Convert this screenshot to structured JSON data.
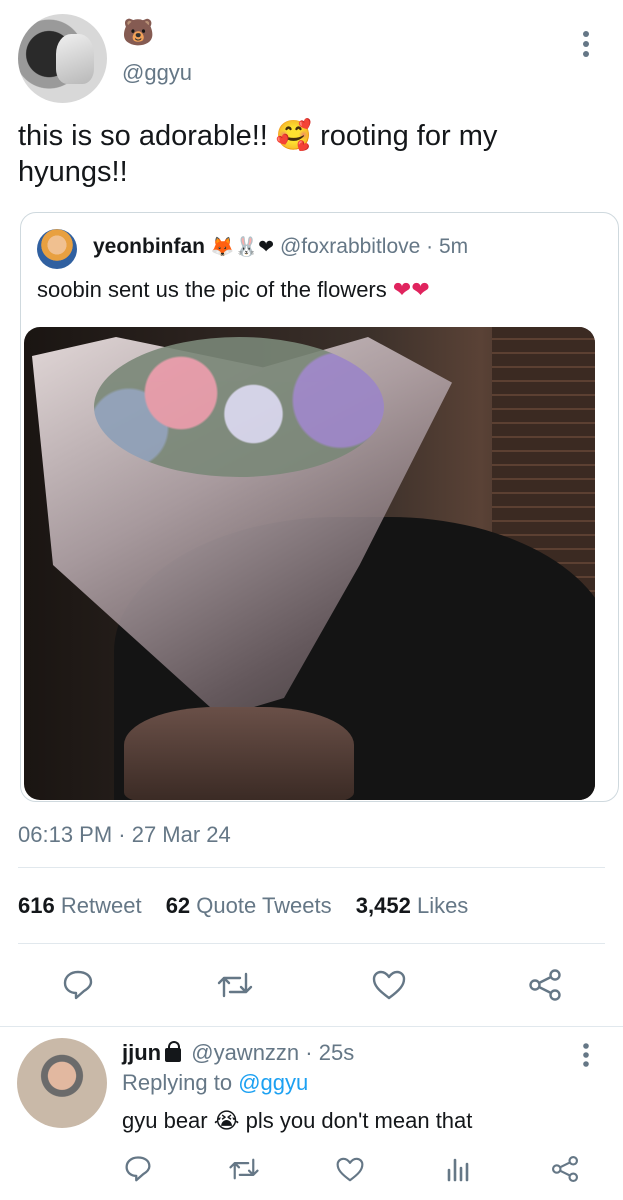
{
  "tweet": {
    "display_name": "🐻",
    "handle": "@ggyu",
    "text": "this is so adorable!! 🥰 rooting for my hyungs!!",
    "timestamp": "06:13 PM · 27 Mar 24",
    "more_icon": "more-vertical-icon"
  },
  "quote": {
    "name": "yeonbinfan",
    "name_emojis": "🦊🐰❤",
    "handle": "@foxrabbitlove",
    "time": "· 5m",
    "text": "soobin sent us the pic of the flowers",
    "text_emojis": "❤❤"
  },
  "stats": {
    "retweets_count": "616",
    "retweets_label": "Retweet",
    "quotes_count": "62",
    "quotes_label": "Quote Tweets",
    "likes_count": "3,452",
    "likes_label": "Likes"
  },
  "actions": [
    "reply-icon",
    "retweet-icon",
    "like-icon",
    "share-icon"
  ],
  "reply": {
    "name": "jjun",
    "handle": "@yawnzzn",
    "time": "· 25s",
    "replying_prefix": "Replying to",
    "replying_to": "@ggyu",
    "text_before": "gyu bear",
    "text_emoji": "😭",
    "text_after": "pls you don't mean that"
  },
  "reply_actions": [
    "reply-icon",
    "retweet-icon",
    "like-icon",
    "analytics-icon",
    "share-icon"
  ],
  "colors": {
    "secondary_text": "#657786",
    "link": "#1da1f2",
    "divider": "#e1e8ed",
    "heart": "#e0245e"
  }
}
